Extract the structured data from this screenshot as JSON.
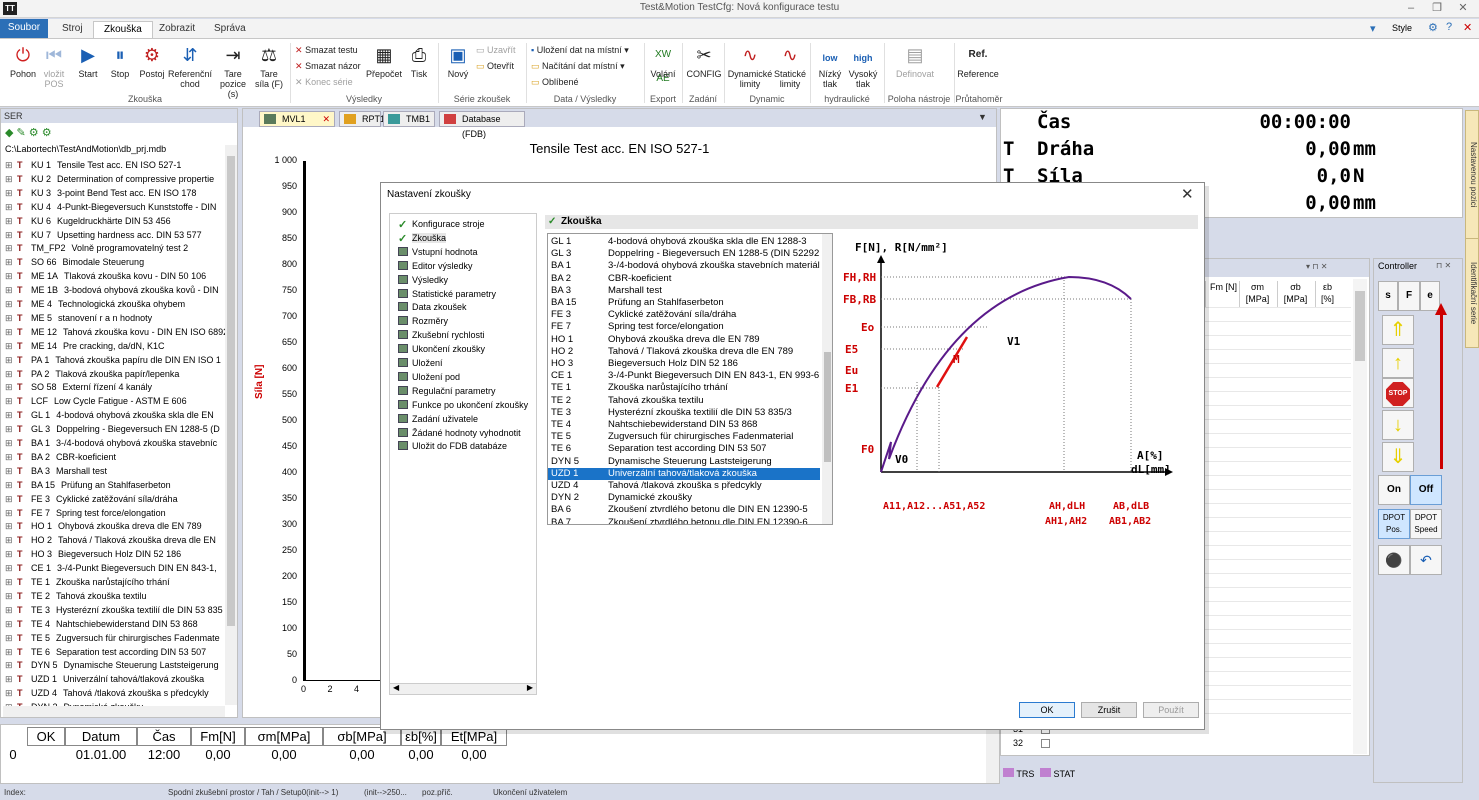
{
  "window": {
    "title": "Test&Motion  TestCfg: Nová konfigurace testu",
    "style_label": "Style"
  },
  "ribbon": {
    "tabs": [
      "Soubor",
      "Stroj",
      "Zkouška",
      "Zobrazit",
      "Správa"
    ],
    "active_tab": "Zkouška",
    "groups": {
      "zkouska": {
        "label": "Zkouška",
        "buttons": [
          "Pohon",
          "vložit POS",
          "Start",
          "Stop",
          "Postoj",
          "Referenční chod",
          "Tare pozice (s)",
          "Tare síla (F)"
        ]
      },
      "vysledky": {
        "label": "Výsledky",
        "items": [
          "Smazat testu",
          "Smazat názor",
          "Konec série"
        ],
        "buttons": [
          "Přepočet",
          "Tisk"
        ]
      },
      "serie": {
        "label": "Série zkoušek",
        "buttons": [
          "Nový"
        ],
        "items": [
          "Uzavřít",
          "Otevřít"
        ]
      },
      "data": {
        "label": "Data / Výsledky",
        "items": [
          "Uložení dat na místní",
          "Načítání dat místní",
          "Oblíbené"
        ]
      },
      "export": {
        "label": "Export",
        "buttons": [
          "Volání"
        ]
      },
      "zadani": {
        "label": "Zadání",
        "buttons": [
          "CONFIG"
        ]
      },
      "dynamic": {
        "label": "Dynamic",
        "buttons": [
          "Dynamické limity",
          "Statické limity"
        ]
      },
      "hydraulicke": {
        "label": "hydraulické",
        "buttons": [
          "Nízký tlak",
          "Vysoký tlak"
        ],
        "icon_labels": [
          "low",
          "high"
        ]
      },
      "poloha": {
        "label": "Poloha nástroje",
        "buttons": [
          "Definovat"
        ]
      },
      "prutahomer": {
        "label": "Průtahoměr",
        "buttons": [
          "Reference"
        ],
        "icon_label": "Ref."
      }
    }
  },
  "ser_panel": {
    "title": "SER",
    "path": "C:\\Labortech\\TestAndMotion\\db_prj.mdb",
    "items": [
      {
        "code": "KU 1",
        "name": "Tensile Test acc. EN ISO 527-1"
      },
      {
        "code": "KU 2",
        "name": "Determination of compressive propertie"
      },
      {
        "code": "KU 3",
        "name": "3-point Bend Test acc. EN ISO 178"
      },
      {
        "code": "KU 4",
        "name": "4-Punkt-Biegeversuch Kunststoffe - DIN"
      },
      {
        "code": "KU 6",
        "name": "Kugeldruckhärte DIN 53 456"
      },
      {
        "code": "KU 7",
        "name": "Upsetting hardness acc. DIN 53 577"
      },
      {
        "code": "TM_FP2",
        "name": "Volně programovatelný test 2"
      },
      {
        "code": "SO 66",
        "name": "Bimodale Steuerung"
      },
      {
        "code": "ME 1A",
        "name": "Tlaková zkouška kovu - DIN 50 106"
      },
      {
        "code": "ME 1B",
        "name": "3-bodová ohybová zkouška kovů - DIN"
      },
      {
        "code": "ME 4",
        "name": "Technologická zkouška ohybem"
      },
      {
        "code": "ME 5",
        "name": "stanovení r a n hodnoty"
      },
      {
        "code": "ME 12",
        "name": "Tahová zkouška kovu - DIN EN ISO 6892"
      },
      {
        "code": "ME 14",
        "name": "Pre cracking, da/dN, K1C"
      },
      {
        "code": "PA 1",
        "name": "Tahová zkouška papíru dle DIN EN ISO 1"
      },
      {
        "code": "PA 2",
        "name": "Tlaková zkouška papír/lepenka"
      },
      {
        "code": "SO 58",
        "name": "Externí řízení 4 kanály"
      },
      {
        "code": "LCF",
        "name": "Low Cycle Fatigue - ASTM E 606"
      },
      {
        "code": "GL 1",
        "name": "4-bodová ohybová zkouška skla dle  EN"
      },
      {
        "code": "GL 3",
        "name": "Doppelring - Biegeversuch EN 1288-5 (D"
      },
      {
        "code": "BA 1",
        "name": "3-/4-bodová ohybová zkouška stavebníc"
      },
      {
        "code": "BA 2",
        "name": "CBR-koeficient"
      },
      {
        "code": "BA 3",
        "name": "Marshall test"
      },
      {
        "code": "BA 15",
        "name": "Prüfung an Stahlfaserbeton"
      },
      {
        "code": "FE 3",
        "name": "Cyklické zatěžování síla/dráha"
      },
      {
        "code": "FE 7",
        "name": "Spring test force/elongation"
      },
      {
        "code": "HO 1",
        "name": "Ohybová zkouška dreva dle EN 789"
      },
      {
        "code": "HO 2",
        "name": "Tahová / Tlaková zkouška dreva dle EN"
      },
      {
        "code": "HO 3",
        "name": "Biegeversuch Holz  DIN 52 186"
      },
      {
        "code": "CE 1",
        "name": "3-/4-Punkt Biegeversuch DIN EN 843-1,"
      },
      {
        "code": "TE 1",
        "name": "Zkouška narůstajícího trhání"
      },
      {
        "code": "TE 2",
        "name": "Tahová zkouška textilu"
      },
      {
        "code": "TE 3",
        "name": "Hysterézní zkouška textilií dle DIN 53 835"
      },
      {
        "code": "TE 4",
        "name": "Nahtschiebewiderstand DIN 53 868"
      },
      {
        "code": "TE 5",
        "name": "Zugversuch für chirurgisches Fadenmate"
      },
      {
        "code": "TE 6",
        "name": "Separation test according DIN 53 507"
      },
      {
        "code": "DYN 5",
        "name": "Dynamische Steuerung Laststeigerung"
      },
      {
        "code": "UZD 1",
        "name": "Univerzální tahová/tlaková zkouška"
      },
      {
        "code": "UZD 4",
        "name": "Tahová /tlaková zkouška s předcykly"
      },
      {
        "code": "DYN 2",
        "name": "Dynamické zkoušky"
      }
    ]
  },
  "doc_tabs": [
    {
      "label": "MVL1",
      "color": "#5a7a5a",
      "active": true
    },
    {
      "label": "RPT1",
      "color": "#e0a020",
      "active": false
    },
    {
      "label": "TMB1",
      "color": "#3a9a9a",
      "active": false
    },
    {
      "label": "Database (FDB)",
      "color": "#d04040",
      "active": false
    }
  ],
  "chart": {
    "title": "Tensile Test acc. EN ISO 527-1",
    "ylabel": "Síla [N]",
    "yticks": [
      "1 000",
      "950",
      "900",
      "850",
      "800",
      "750",
      "700",
      "650",
      "600",
      "550",
      "500",
      "450",
      "400",
      "350",
      "300",
      "250",
      "200",
      "150",
      "100",
      "50",
      "0"
    ],
    "xticks": [
      "0",
      "2",
      "4"
    ]
  },
  "chart_data": {
    "type": "line",
    "title": "Tensile Test acc. EN ISO 527-1",
    "xlabel": "",
    "ylabel": "Síla [N]",
    "ylim": [
      0,
      1000
    ],
    "series": []
  },
  "num_display": [
    {
      "t": "",
      "label": "Čas",
      "value": "00:00:00",
      "unit": ""
    },
    {
      "t": "T",
      "label": "Dráha",
      "value": "0,00",
      "unit": "mm"
    },
    {
      "t": "T",
      "label": "Síla",
      "value": "0,0",
      "unit": "N"
    },
    {
      "t": "T",
      "label": "",
      "value": "0,00",
      "unit": "mm"
    }
  ],
  "side_tabs": [
    "Nastavenou pozici",
    "Identifikační serie"
  ],
  "result_table": {
    "headers": [
      "Fm [N]",
      "σm [MPa]",
      "σb [MPa]",
      "εb [%]"
    ],
    "rows": [
      "31",
      "32"
    ]
  },
  "controller": {
    "title": "Controller",
    "mode_buttons": [
      "s",
      "F",
      "e"
    ],
    "stop_label": "STOP",
    "on_label": "On",
    "off_label": "Off",
    "dpot_pos": "DPOT Pos.",
    "dpot_speed": "DPOT Speed"
  },
  "bottom_tabs": [
    "TRS",
    "STAT"
  ],
  "bottom_grid": {
    "headers": [
      "OK",
      "Datum",
      "Čas",
      "Fm[N]",
      "σm[MPa]",
      "σb[MPa]",
      "εb[%]",
      "Et[MPa]"
    ],
    "row_index": "0",
    "row": [
      "",
      "01.01.00",
      "12:00",
      "0,00",
      "0,00",
      "0,00",
      "0,00",
      "0,00"
    ]
  },
  "statusbar": {
    "index": "Index:",
    "space": "Spodní zkušební prostor / Tah / Setup0(init--> 1)",
    "init": "(init-->250...",
    "poz": "poz.příč.",
    "end": "Ukončení uživatelem"
  },
  "dialog": {
    "title": "Nastavení zkoušky",
    "section": "Zkouška",
    "tree": [
      {
        "label": "Konfigurace stroje",
        "check": true
      },
      {
        "label": "Zkouška",
        "check": true,
        "selected": true
      },
      {
        "label": "Vstupní hodnota"
      },
      {
        "label": "Editor výsledky"
      },
      {
        "label": "Výsledky"
      },
      {
        "label": "Statistické parametry"
      },
      {
        "label": "Data zkoušek"
      },
      {
        "label": "Rozměry"
      },
      {
        "label": "Zkušební rychlosti"
      },
      {
        "label": "Ukončení zkoušky"
      },
      {
        "label": "Uložení"
      },
      {
        "label": "Uložení pod"
      },
      {
        "label": "Regulační parametry"
      },
      {
        "label": "Funkce po ukončení zkoušky"
      },
      {
        "label": "Zadání uživatele"
      },
      {
        "label": "Žádané hodnoty vyhodnotit"
      },
      {
        "label": "Uložit do FDB databáze"
      }
    ],
    "tests": [
      {
        "code": "GL 1",
        "name": "4-bodová ohybová zkouška skla dle  EN 1288-3"
      },
      {
        "code": "GL 3",
        "name": "Doppelring - Biegeversuch EN 1288-5 (DIN 52292"
      },
      {
        "code": "BA 1",
        "name": "3-/4-bodová ohybová zkouška stavebních materiálů"
      },
      {
        "code": "BA 2",
        "name": "CBR-koeficient"
      },
      {
        "code": "BA 3",
        "name": "Marshall test"
      },
      {
        "code": "BA 15",
        "name": "Prüfung an Stahlfaserbeton"
      },
      {
        "code": "FE 3",
        "name": "Cyklické zatěžování síla/dráha"
      },
      {
        "code": "FE 7",
        "name": "Spring test force/elongation"
      },
      {
        "code": "HO 1",
        "name": "Ohybová zkouška dreva dle EN 789"
      },
      {
        "code": "HO 2",
        "name": "Tahová / Tlaková zkouška dreva dle EN 789"
      },
      {
        "code": "HO 3",
        "name": "Biegeversuch Holz  DIN 52 186"
      },
      {
        "code": "CE 1",
        "name": "3-/4-Punkt Biegeversuch DIN EN 843-1, EN 993-6"
      },
      {
        "code": "TE 1",
        "name": "Zkouška narůstajícího trhání"
      },
      {
        "code": "TE 2",
        "name": "Tahová zkouška textilu"
      },
      {
        "code": "TE 3",
        "name": "Hysterézní zkouška textilií dle DIN 53 835/3"
      },
      {
        "code": "TE 4",
        "name": "Nahtschiebewiderstand DIN 53 868"
      },
      {
        "code": "TE 5",
        "name": "Zugversuch für chirurgisches Fadenmaterial"
      },
      {
        "code": "TE 6",
        "name": "Separation test according DIN 53 507"
      },
      {
        "code": "DYN 5",
        "name": "Dynamische Steuerung Laststeigerung"
      },
      {
        "code": "UZD 1",
        "name": "Univerzální tahová/tlaková zkouška",
        "selected": true
      },
      {
        "code": "UZD 4",
        "name": "Tahová /tlaková zkouška s předcykly"
      },
      {
        "code": "DYN 2",
        "name": "Dynamické zkoušky"
      },
      {
        "code": "BA 6",
        "name": "Zkoušení ztvrdlého betonu dle DIN EN 12390-5"
      },
      {
        "code": "BA 7",
        "name": "Zkoušení ztvrdlého betonu dle DIN EN 12390-6"
      }
    ],
    "diagram": {
      "axis_y": "F[N], R[N/mm²]",
      "axis_x1": "A[%]",
      "axis_x2": "dL[mm]",
      "y_labels": [
        "FH,RH",
        "FB,RB",
        "Eo",
        "E5",
        "Eu",
        "E1",
        "F0"
      ],
      "curve_labels": [
        "V1",
        "M",
        "V0"
      ],
      "x_labels": [
        "A11,A12...A51,A52",
        "AH,dLH",
        "AH1,AH2",
        "AB,dLB",
        "AB1,AB2"
      ]
    },
    "buttons": {
      "ok": "OK",
      "cancel": "Zrušit",
      "apply": "Použít"
    }
  }
}
